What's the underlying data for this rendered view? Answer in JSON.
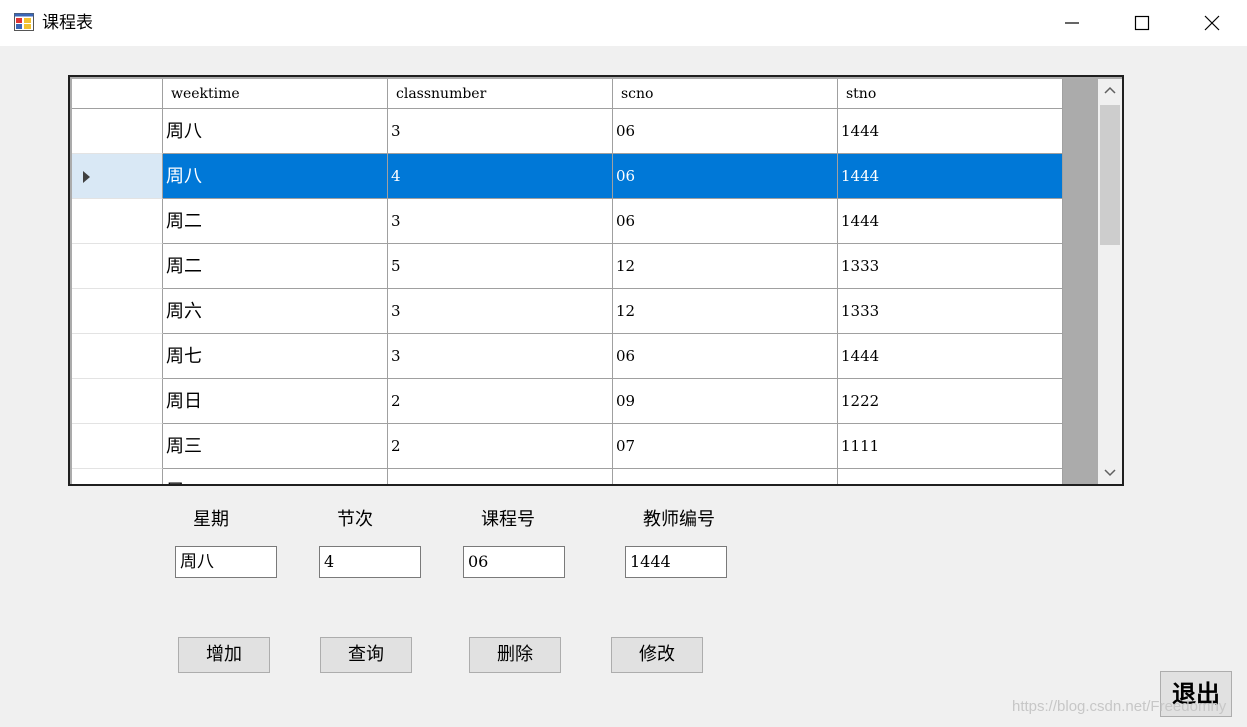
{
  "window": {
    "title": "课程表",
    "icon": "app-form-icon",
    "controls": [
      "minimize-icon",
      "maximize-icon",
      "close-icon"
    ]
  },
  "grid": {
    "columns": [
      "weektime",
      "classnumber",
      "scno",
      "stno"
    ],
    "rows": [
      {
        "weektime": "周八",
        "classnumber": "3",
        "scno": "06",
        "stno": "1444"
      },
      {
        "weektime": "周八",
        "classnumber": "4",
        "scno": "06",
        "stno": "1444",
        "selected": true
      },
      {
        "weektime": "周二",
        "classnumber": "3",
        "scno": "06",
        "stno": "1444"
      },
      {
        "weektime": "周二",
        "classnumber": "5",
        "scno": "12",
        "stno": "1333"
      },
      {
        "weektime": "周六",
        "classnumber": "3",
        "scno": "12",
        "stno": "1333"
      },
      {
        "weektime": "周七",
        "classnumber": "3",
        "scno": "06",
        "stno": "1444"
      },
      {
        "weektime": "周日",
        "classnumber": "2",
        "scno": "09",
        "stno": "1222"
      },
      {
        "weektime": "周三",
        "classnumber": "2",
        "scno": "07",
        "stno": "1111"
      },
      {
        "weektime": "周二",
        "classnumber": "",
        "scno": "",
        "stno": ""
      }
    ],
    "selection_color": "#0078d7"
  },
  "form": {
    "labels": {
      "weekday": "星期",
      "period": "节次",
      "course_no": "课程号",
      "teacher_no": "教师编号"
    },
    "values": {
      "weekday": "周八",
      "period": "4",
      "course_no": "06",
      "teacher_no": "1444"
    }
  },
  "buttons": {
    "add": "增加",
    "query": "查询",
    "delete": "删除",
    "modify": "修改",
    "exit": "退出"
  },
  "watermark": "https://blog.csdn.net/Freedomhy"
}
